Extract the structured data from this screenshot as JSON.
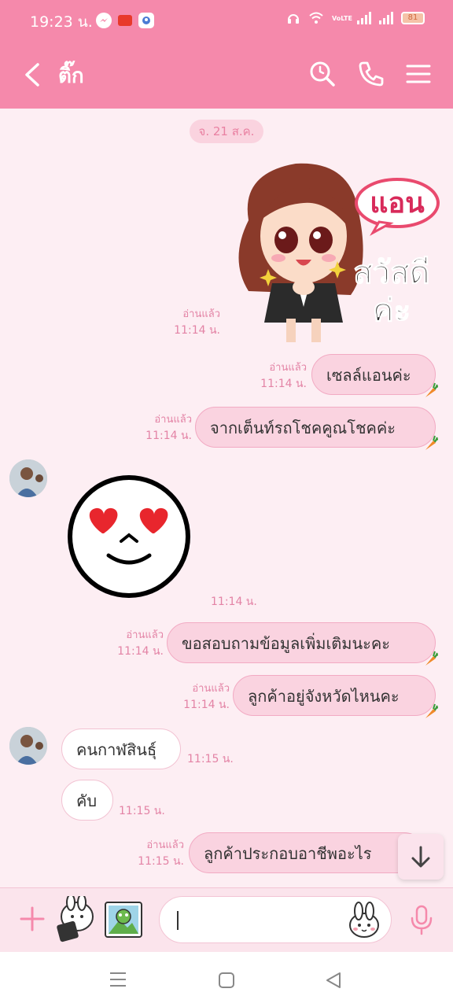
{
  "status_bar": {
    "time": "19:23 น.",
    "battery": "81",
    "network_label": "VoLTE"
  },
  "header": {
    "title": "ติ๊ก"
  },
  "chat": {
    "date_chip": "จ. 21 ส.ค.",
    "sticker_text": {
      "name": "แอน",
      "greeting_line1": "สวัสดี",
      "greeting_line2": "ค่ะ"
    },
    "messages": [
      {
        "side": "out",
        "type": "sticker",
        "read": "อ่านแล้ว",
        "time": "11:14 น."
      },
      {
        "side": "out",
        "text": "เซลล์แอนค่ะ",
        "read": "อ่านแล้ว",
        "time": "11:14 น."
      },
      {
        "side": "out",
        "text": "จากเต็นท์รถโชคคูณโชคค่ะ",
        "read": "อ่านแล้ว",
        "time": "11:14 น."
      },
      {
        "side": "in",
        "type": "sticker",
        "time": "11:14 น."
      },
      {
        "side": "out",
        "text": "ขอสอบถามข้อมูลเพิ่มเติมนะคะ",
        "read": "อ่านแล้ว",
        "time": "11:14 น."
      },
      {
        "side": "out",
        "text": "ลูกค้าอยู่จังหวัดไหนคะ",
        "read": "อ่านแล้ว",
        "time": "11:14 น."
      },
      {
        "side": "in",
        "text": "คนกาฬสินธุ์",
        "time": "11:15 น."
      },
      {
        "side": "in",
        "text": "คับ",
        "time": "11:15 น."
      },
      {
        "side": "out",
        "text": "ลูกค้าประกอบอาชีพอะไร",
        "read": "อ่านแล้ว",
        "time": "11:15 น."
      }
    ]
  },
  "colors": {
    "header_bg": "#f589ab",
    "chat_bg": "#fdeef3",
    "bubble_out": "#fad3e0",
    "meta_text": "#e383a5"
  }
}
